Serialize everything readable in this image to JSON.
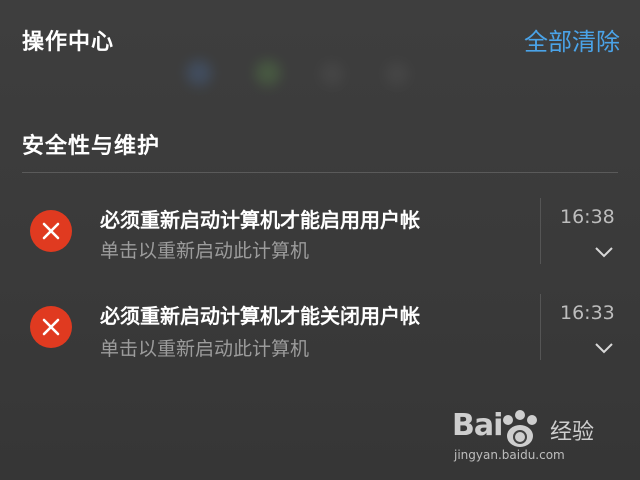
{
  "window": {
    "title": "操作中心",
    "clear_all_label": "全部清除"
  },
  "group": {
    "title": "安全性与维护"
  },
  "notifications": [
    {
      "icon": "error-icon",
      "title": "必须重新启动计算机才能启用用户帐",
      "body": "单击以重新启动此计算机",
      "time": "16:38",
      "expand_icon": "chevron-down-icon"
    },
    {
      "icon": "error-icon",
      "title": "必须重新启动计算机才能关闭用户帐",
      "body": "单击以重新启动此计算机",
      "time": "16:33",
      "expand_icon": "chevron-down-icon"
    }
  ],
  "watermark": {
    "logo_text": "Bai",
    "logo_suffix": "经验",
    "url": "jingyan.baidu.com"
  },
  "colors": {
    "background": "#3b3b3b",
    "accent": "#4aa3e8",
    "error": "#e03a20",
    "secondary_text": "#9c9c9c"
  }
}
